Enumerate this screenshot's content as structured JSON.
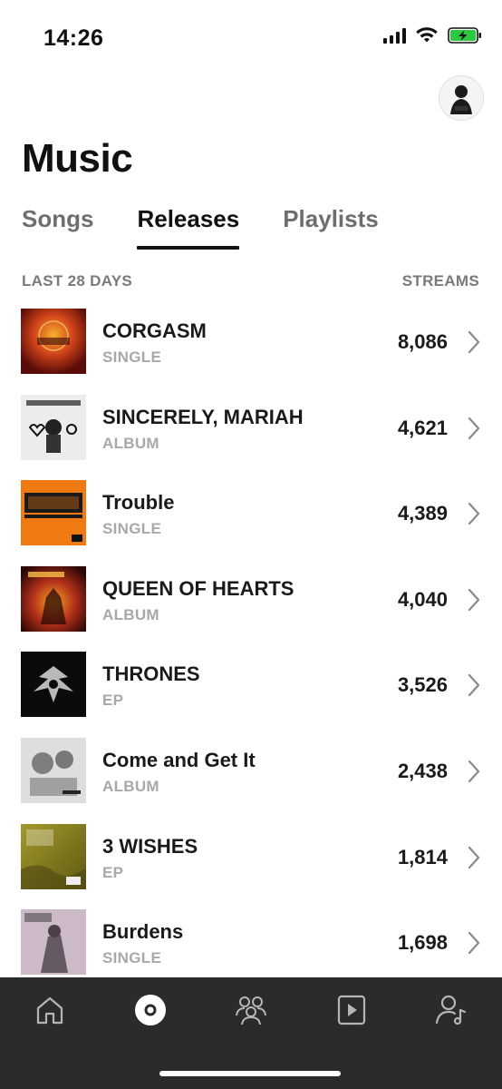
{
  "status": {
    "time": "14:26"
  },
  "header": {
    "title": "Music"
  },
  "tabs": [
    {
      "label": "Songs",
      "active": false
    },
    {
      "label": "Releases",
      "active": true
    },
    {
      "label": "Playlists",
      "active": false
    }
  ],
  "list_header": {
    "period": "LAST 28 DAYS",
    "metric": "STREAMS"
  },
  "releases": [
    {
      "title": "CORGASM",
      "type": "SINGLE",
      "streams": "8,086",
      "cover_color": "#b3261e"
    },
    {
      "title": "SINCERELY, MARIAH",
      "type": "ALBUM",
      "streams": "4,621",
      "cover_color": "#e8e8e8"
    },
    {
      "title": "Trouble",
      "type": "SINGLE",
      "streams": "4,389",
      "cover_color": "#f07a12"
    },
    {
      "title": "QUEEN OF HEARTS",
      "type": "ALBUM",
      "streams": "4,040",
      "cover_color": "#c1441a"
    },
    {
      "title": "THRONES",
      "type": "EP",
      "streams": "3,526",
      "cover_color": "#111111"
    },
    {
      "title": "Come and Get It",
      "type": "ALBUM",
      "streams": "2,438",
      "cover_color": "#d9d9d9"
    },
    {
      "title": "3 WISHES",
      "type": "EP",
      "streams": "1,814",
      "cover_color": "#8a8420"
    },
    {
      "title": "Burdens",
      "type": "SINGLE",
      "streams": "1,698",
      "cover_color": "#c9b6c4"
    }
  ],
  "bottom_nav": [
    {
      "icon": "home-icon",
      "active": false
    },
    {
      "icon": "music-disc-icon",
      "active": true
    },
    {
      "icon": "audience-icon",
      "active": false
    },
    {
      "icon": "video-icon",
      "active": false
    },
    {
      "icon": "profile-icon",
      "active": false
    }
  ],
  "colors": {
    "nav_bg": "#2b2b2b",
    "battery": "#2bc840",
    "muted_text": "#a8a8a8"
  }
}
